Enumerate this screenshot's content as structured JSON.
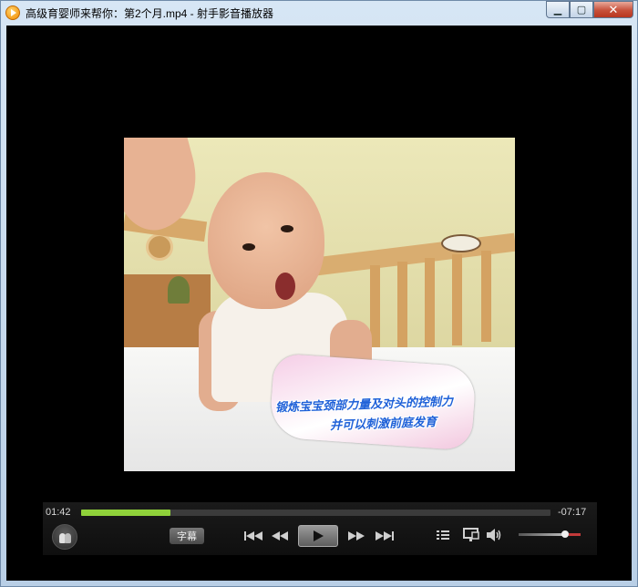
{
  "window": {
    "title": "高级育婴师来帮你：第2个月.mp4 - 射手影音播放器",
    "min_label": "▁",
    "max_label": "▢",
    "close_label": "✕"
  },
  "video": {
    "caption_line1": "锻炼宝宝颈部力量及对头的控制力",
    "caption_line2": "并可以刺激前庭发育"
  },
  "player": {
    "elapsed": "01:42",
    "remaining": "-07:17",
    "progress_fraction": 0.19,
    "volume_fraction": 0.78,
    "subtitle_label": "字幕",
    "accent_color": "#8fd13a"
  },
  "icons": {
    "people": "people-icon",
    "skip_back": "skip-back-icon",
    "rewind": "rewind-icon",
    "play": "play-icon",
    "forward": "fast-forward-icon",
    "skip_forward": "skip-forward-icon",
    "playlist": "playlist-icon",
    "screen": "screen-mode-icon",
    "volume": "volume-icon"
  }
}
